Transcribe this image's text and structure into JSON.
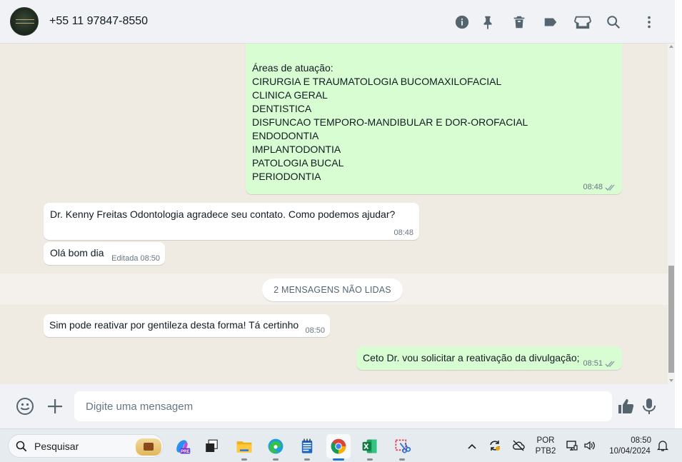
{
  "header": {
    "contact_name": "+55 11 97847-8550",
    "icons": [
      "info-icon",
      "pin-icon",
      "trash-icon",
      "label-icon",
      "store-icon",
      "search-icon",
      "menu-icon"
    ]
  },
  "messages": [
    {
      "direction": "outgoing",
      "text": "Áreas de atuação:\nCIRURGIA E TRAUMATOLOGIA BUCOMAXILOFACIAL\nCLINICA GERAL\nDENTISTICA\nDISFUNCAO TEMPORO-MANDIBULAR E DOR-OROFACIAL\nENDODONTIA\nIMPLANTODONTIA\nPATOLOGIA BUCAL\nPERIODONTIA",
      "time": "08:48",
      "status": "read"
    },
    {
      "direction": "incoming",
      "text": "Dr. Kenny Freitas Odontologia agradece seu contato. Como podemos ajudar?",
      "time": "08:48"
    },
    {
      "direction": "incoming",
      "text": "Olá bom dia",
      "edited_label": "Editada",
      "time": "08:50"
    },
    {
      "direction": "incoming",
      "text": "Sim pode reativar por gentileza desta forma! Tá certinho",
      "time": "08:50"
    },
    {
      "direction": "outgoing",
      "text": "Ceto Dr. vou solicitar a reativação da divulgação;",
      "time": "08:51",
      "status": "read"
    }
  ],
  "unread_banner": "2 MENSAGENS NÃO LIDAS",
  "compose": {
    "placeholder": "Digite uma mensagem"
  },
  "taskbar": {
    "search_placeholder": "Pesquisar",
    "apps": [
      "copilot-icon",
      "task-view-icon",
      "file-explorer-icon",
      "edge-icon",
      "notepad-icon",
      "chrome-icon",
      "excel-icon",
      "snipping-tool-icon"
    ],
    "active_app": "chrome-icon",
    "language_top": "POR",
    "language_bottom": "PTB2",
    "time": "08:50",
    "date": "10/04/2024"
  },
  "colors": {
    "outgoing_bubble": "#d9fdd3",
    "incoming_bubble": "#ffffff",
    "chat_background": "#efeae2",
    "header_background": "#f0f2f5"
  }
}
